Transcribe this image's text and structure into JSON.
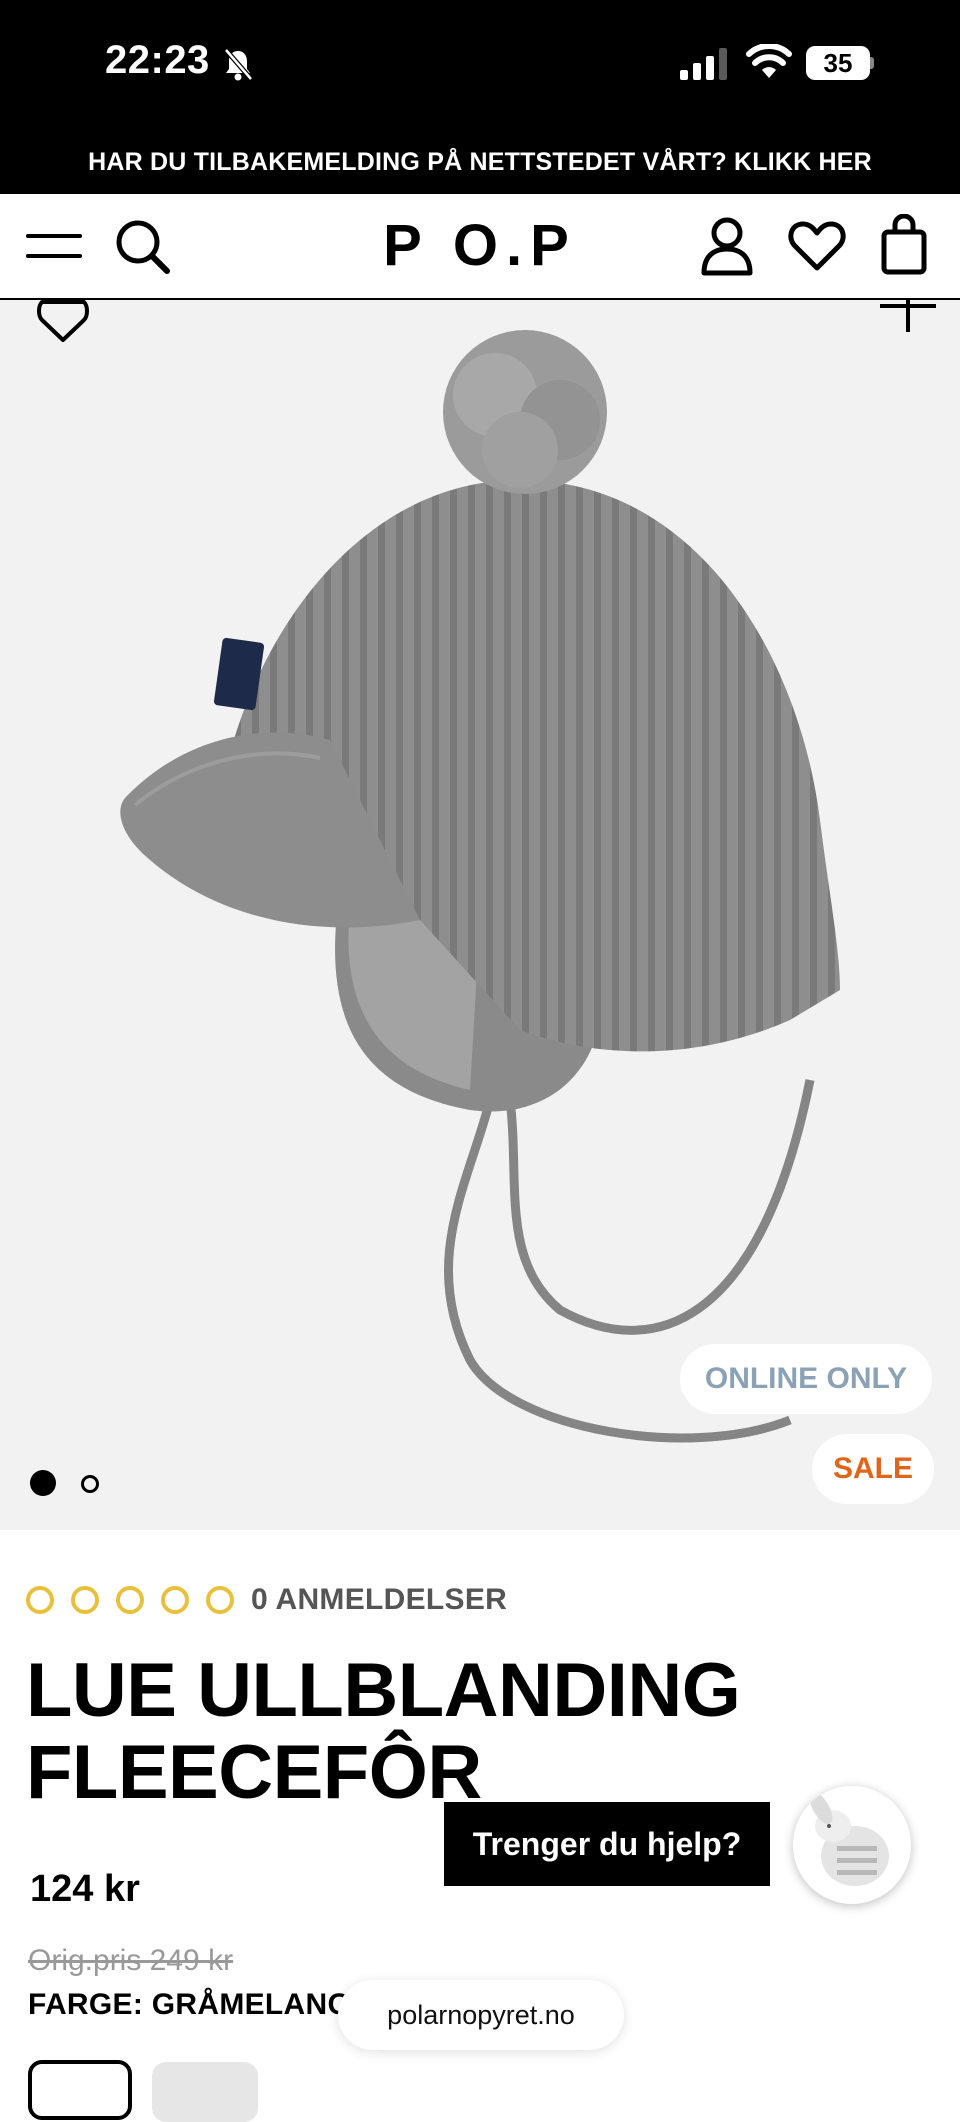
{
  "status_bar": {
    "time": "22:23",
    "battery": "35"
  },
  "banner": {
    "text": "HAR DU TILBAKEMELDING PÅ NETTSTEDET VÅRT? KLIKK HER"
  },
  "header": {
    "logo": "P O.P"
  },
  "product": {
    "badges": {
      "online": "ONLINE ONLY",
      "sale": "SALE"
    },
    "carousel": {
      "total_slides": 2,
      "active_slide": 1
    },
    "rating": {
      "stars": 0,
      "max_stars": 5,
      "reviews_label": "0 ANMELDELSER"
    },
    "title_line_1": "LUE ULLBLANDING",
    "title_line_2": "FLEECEFÔR",
    "price": "124 kr",
    "orig_price": "Orig.pris 249 kr",
    "color_label": "FARGE: GRÅMELANGE"
  },
  "help": {
    "label": "Trenger du hjelp?"
  },
  "browser": {
    "url": "polarnopyret.no"
  },
  "colors": {
    "accent_sale": "#e0651b",
    "online_badge": "#8ba2b6",
    "star_outline": "#e8c03c"
  },
  "icons": [
    "bell-off-icon",
    "signal-icon",
    "wifi-icon",
    "battery-icon",
    "menu-icon",
    "search-icon",
    "account-icon",
    "heart-icon",
    "cart-icon",
    "plus-icon"
  ]
}
